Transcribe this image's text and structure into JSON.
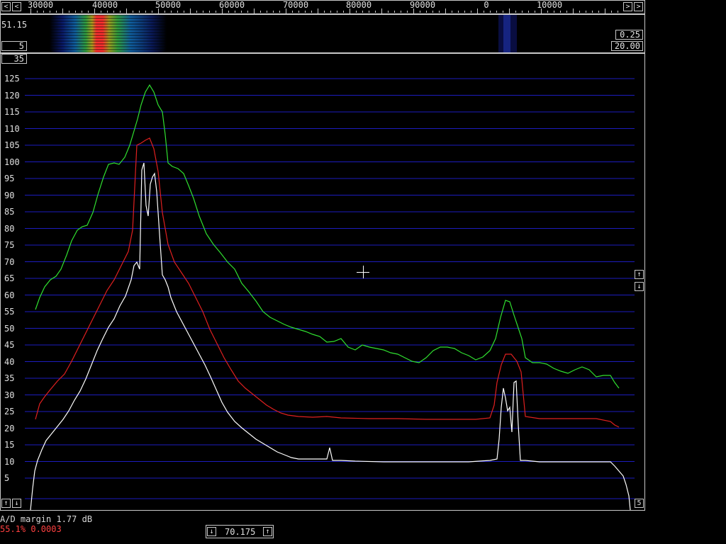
{
  "freq_scale": [
    "30000",
    "40000",
    "50000",
    "60000",
    "70000",
    "80000",
    "90000",
    "0",
    "10000"
  ],
  "waterfall": {
    "left_value": "51.15",
    "left_box": "5",
    "right_box_top": "0.25",
    "right_box_bottom": "20.00"
  },
  "spectrum": {
    "top_box": "35",
    "bottom_right_box": "5",
    "y_labels": [
      "125",
      "120",
      "115",
      "110",
      "105",
      "100",
      "95",
      "90",
      "85",
      "80",
      "75",
      "70",
      "65",
      "60",
      "55",
      "50",
      "45",
      "40",
      "35",
      "30",
      "25",
      "20",
      "15",
      "10",
      "5"
    ]
  },
  "status": {
    "ad_margin": "A/D margin 1.77 dB",
    "cpu_load": "55.1% 0.0003"
  },
  "frequency_box": {
    "value": "70.175"
  },
  "colors": {
    "grid": "#1d1dbe",
    "trace_green": "#30e030",
    "trace_red": "#e02020",
    "trace_white": "#ffffff",
    "status_red": "#ff4040"
  },
  "icons": {
    "scroll_left": "chevron-left-icon",
    "scroll_right": "chevron-right-icon",
    "up": "arrow-up-icon",
    "down": "arrow-down-icon"
  }
}
